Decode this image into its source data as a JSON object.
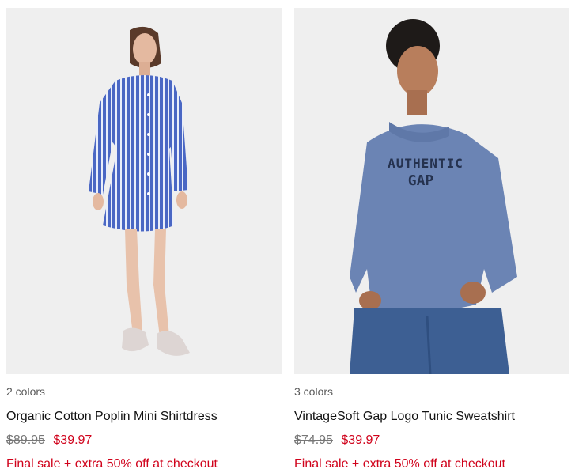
{
  "products": [
    {
      "colors": "2 colors",
      "title": "Organic Cotton Poplin Mini Shirtdress",
      "price_original": "$89.95",
      "price_sale": "$39.97",
      "promo": "Final sale + extra 50% off at checkout",
      "image_icon": "model-shirtdress-photo"
    },
    {
      "colors": "3 colors",
      "title": "VintageSoft Gap Logo Tunic Sweatshirt",
      "price_original": "$74.95",
      "price_sale": "$39.97",
      "promo": "Final sale + extra 50% off at checkout",
      "image_icon": "model-sweatshirt-photo",
      "graphic_text": [
        "AUTHENTIC",
        "GAP"
      ]
    }
  ],
  "colors": {
    "sale_red": "#d0021b",
    "strike_gray": "#777777",
    "image_bg": "#efefef"
  }
}
